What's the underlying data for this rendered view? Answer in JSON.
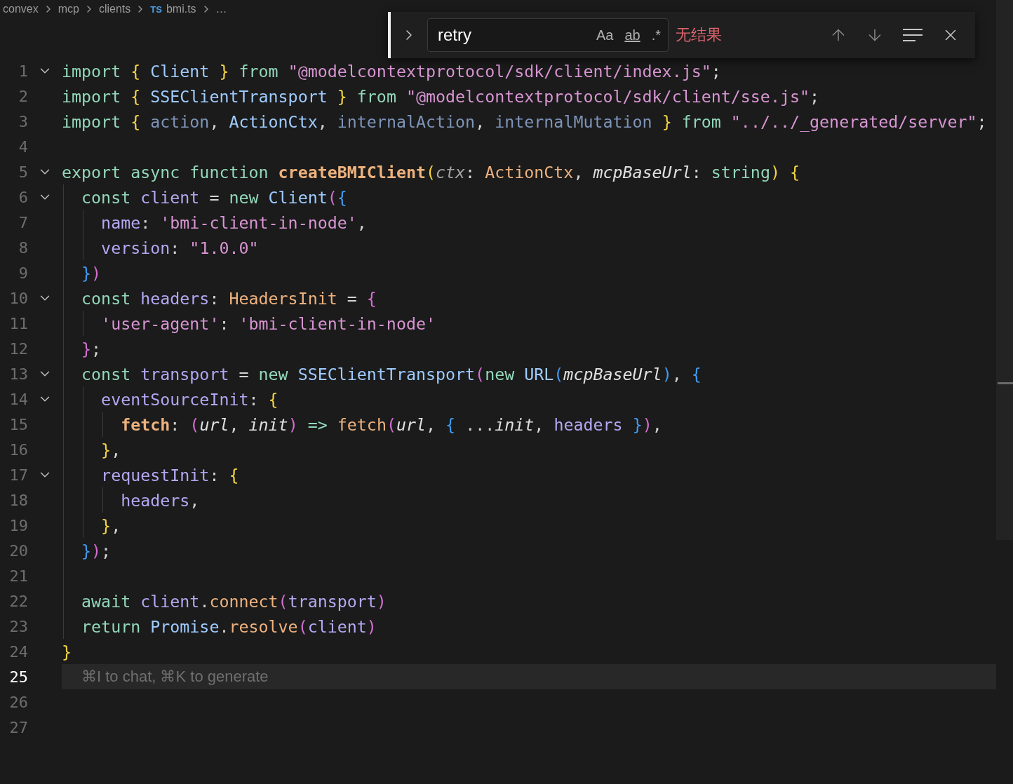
{
  "breadcrumb": {
    "items": [
      {
        "label": "convex",
        "kind": "folder"
      },
      {
        "label": "mcp",
        "kind": "folder"
      },
      {
        "label": "clients",
        "kind": "folder"
      },
      {
        "label": "bmi.ts",
        "kind": "file",
        "badge": "TS"
      },
      {
        "label": "…",
        "kind": "more"
      }
    ]
  },
  "find_widget": {
    "query": "retry",
    "options": [
      {
        "kind": "case",
        "label": "Aa"
      },
      {
        "kind": "word",
        "label": "ab"
      },
      {
        "kind": "regex",
        "label": ".*"
      }
    ],
    "status": "无结果"
  },
  "editor": {
    "hint": "⌘I to chat, ⌘K to generate",
    "lines": [
      {
        "number": "1",
        "fold_expanded": true,
        "tokens": [
          {
            "kind": "kw",
            "text": "import "
          },
          {
            "kind": "b1",
            "text": "{"
          },
          {
            "kind": "type",
            "text": " Client "
          },
          {
            "kind": "b1",
            "text": "}"
          },
          {
            "kind": "kw",
            "text": " from "
          },
          {
            "kind": "str",
            "text": "\"@modelcontextprotocol/sdk/client/index.js\""
          },
          {
            "kind": "p",
            "text": ";"
          }
        ]
      },
      {
        "number": "2",
        "tokens": [
          {
            "kind": "kw",
            "text": "import "
          },
          {
            "kind": "b1",
            "text": "{"
          },
          {
            "kind": "type",
            "text": " SSEClientTransport "
          },
          {
            "kind": "b1",
            "text": "}"
          },
          {
            "kind": "kw",
            "text": " from "
          },
          {
            "kind": "str",
            "text": "\"@modelcontextprotocol/sdk/client/sse.js\""
          },
          {
            "kind": "p",
            "text": ";"
          }
        ]
      },
      {
        "number": "3",
        "tokens": [
          {
            "kind": "kw",
            "text": "import "
          },
          {
            "kind": "b1",
            "text": "{"
          },
          {
            "kind": "dim",
            "text": " action"
          },
          {
            "kind": "p",
            "text": ", "
          },
          {
            "kind": "type",
            "text": "ActionCtx"
          },
          {
            "kind": "p",
            "text": ", "
          },
          {
            "kind": "dim",
            "text": "internalAction"
          },
          {
            "kind": "p",
            "text": ", "
          },
          {
            "kind": "dim",
            "text": "internalMutation "
          },
          {
            "kind": "b1",
            "text": "}"
          },
          {
            "kind": "kw",
            "text": " from "
          },
          {
            "kind": "str",
            "text": "\"../../_generated/server\""
          },
          {
            "kind": "p",
            "text": ";"
          }
        ]
      },
      {
        "number": "4"
      },
      {
        "number": "5",
        "fold_expanded": true,
        "tokens": [
          {
            "kind": "kw",
            "text": "export async function "
          },
          {
            "kind": "fnb",
            "text": "createBMIClient"
          },
          {
            "kind": "b1",
            "text": "("
          },
          {
            "kind": "paramdim",
            "text": "ctx"
          },
          {
            "kind": "p",
            "text": ": "
          },
          {
            "kind": "fn",
            "text": "ActionCtx"
          },
          {
            "kind": "p",
            "text": ", "
          },
          {
            "kind": "param",
            "text": "mcpBaseUrl"
          },
          {
            "kind": "p",
            "text": ": "
          },
          {
            "kind": "kw",
            "text": "string"
          },
          {
            "kind": "b1",
            "text": ") {"
          }
        ]
      },
      {
        "number": "6",
        "fold_expanded": true,
        "tokens": [
          {
            "kind": "kw",
            "text": "  const"
          },
          {
            "kind": "var",
            "text": " client"
          },
          {
            "kind": "p",
            "text": " = "
          },
          {
            "kind": "kw",
            "text": "new"
          },
          {
            "kind": "type",
            "text": " Client"
          },
          {
            "kind": "b2",
            "text": "("
          },
          {
            "kind": "b3",
            "text": "{"
          }
        ]
      },
      {
        "number": "7",
        "tokens": [
          {
            "kind": "var",
            "text": "    name"
          },
          {
            "kind": "p",
            "text": ": "
          },
          {
            "kind": "str",
            "text": "'bmi-client-in-node'"
          },
          {
            "kind": "p",
            "text": ","
          }
        ]
      },
      {
        "number": "8",
        "tokens": [
          {
            "kind": "var",
            "text": "    version"
          },
          {
            "kind": "p",
            "text": ": "
          },
          {
            "kind": "str",
            "text": "\"1.0.0\""
          }
        ]
      },
      {
        "number": "9",
        "tokens": [
          {
            "kind": "b3",
            "text": "  }"
          },
          {
            "kind": "b2",
            "text": ")"
          }
        ]
      },
      {
        "number": "10",
        "fold_expanded": true,
        "tokens": [
          {
            "kind": "kw",
            "text": "  const"
          },
          {
            "kind": "var",
            "text": " headers"
          },
          {
            "kind": "p",
            "text": ": "
          },
          {
            "kind": "fn",
            "text": "HeadersInit"
          },
          {
            "kind": "p",
            "text": " = "
          },
          {
            "kind": "b2",
            "text": "{"
          }
        ]
      },
      {
        "number": "11",
        "tokens": [
          {
            "kind": "str",
            "text": "    'user-agent'"
          },
          {
            "kind": "p",
            "text": ": "
          },
          {
            "kind": "str",
            "text": "'bmi-client-in-node'"
          }
        ]
      },
      {
        "number": "12",
        "tokens": [
          {
            "kind": "b2",
            "text": "  }"
          },
          {
            "kind": "p",
            "text": ";"
          }
        ]
      },
      {
        "number": "13",
        "fold_expanded": true,
        "tokens": [
          {
            "kind": "kw",
            "text": "  const"
          },
          {
            "kind": "var",
            "text": " transport"
          },
          {
            "kind": "p",
            "text": " = "
          },
          {
            "kind": "kw",
            "text": "new"
          },
          {
            "kind": "type",
            "text": " SSEClientTransport"
          },
          {
            "kind": "b2",
            "text": "("
          },
          {
            "kind": "kw",
            "text": "new"
          },
          {
            "kind": "type",
            "text": " URL"
          },
          {
            "kind": "b3",
            "text": "("
          },
          {
            "kind": "param",
            "text": "mcpBaseUrl"
          },
          {
            "kind": "b3",
            "text": ")"
          },
          {
            "kind": "p",
            "text": ", "
          },
          {
            "kind": "b3",
            "text": "{"
          }
        ]
      },
      {
        "number": "14",
        "fold_expanded": true,
        "tokens": [
          {
            "kind": "var",
            "text": "    eventSourceInit"
          },
          {
            "kind": "p",
            "text": ": "
          },
          {
            "kind": "b1",
            "text": "{"
          }
        ]
      },
      {
        "number": "15",
        "tokens": [
          {
            "kind": "fnb",
            "text": "      fetch"
          },
          {
            "kind": "p",
            "text": ": "
          },
          {
            "kind": "b2",
            "text": "("
          },
          {
            "kind": "param",
            "text": "url"
          },
          {
            "kind": "p",
            "text": ", "
          },
          {
            "kind": "param",
            "text": "init"
          },
          {
            "kind": "b2",
            "text": ")"
          },
          {
            "kind": "kw",
            "text": " => "
          },
          {
            "kind": "fn",
            "text": "fetch"
          },
          {
            "kind": "b2",
            "text": "("
          },
          {
            "kind": "param",
            "text": "url"
          },
          {
            "kind": "p",
            "text": ", "
          },
          {
            "kind": "b3",
            "text": "{"
          },
          {
            "kind": "p",
            "text": " ..."
          },
          {
            "kind": "param",
            "text": "init"
          },
          {
            "kind": "p",
            "text": ", "
          },
          {
            "kind": "var",
            "text": "headers "
          },
          {
            "kind": "b3",
            "text": "}"
          },
          {
            "kind": "b2",
            "text": ")"
          },
          {
            "kind": "p",
            "text": ","
          }
        ]
      },
      {
        "number": "16",
        "tokens": [
          {
            "kind": "b1",
            "text": "    }"
          },
          {
            "kind": "p",
            "text": ","
          }
        ]
      },
      {
        "number": "17",
        "fold_expanded": true,
        "tokens": [
          {
            "kind": "var",
            "text": "    requestInit"
          },
          {
            "kind": "p",
            "text": ": "
          },
          {
            "kind": "b1",
            "text": "{"
          }
        ]
      },
      {
        "number": "18",
        "tokens": [
          {
            "kind": "var",
            "text": "      headers"
          },
          {
            "kind": "p",
            "text": ","
          }
        ]
      },
      {
        "number": "19",
        "tokens": [
          {
            "kind": "b1",
            "text": "    }"
          },
          {
            "kind": "p",
            "text": ","
          }
        ]
      },
      {
        "number": "20",
        "tokens": [
          {
            "kind": "b3",
            "text": "  }"
          },
          {
            "kind": "b2",
            "text": ")"
          },
          {
            "kind": "p",
            "text": ";"
          }
        ]
      },
      {
        "number": "21"
      },
      {
        "number": "22",
        "tokens": [
          {
            "kind": "kw",
            "text": "  await"
          },
          {
            "kind": "var",
            "text": " client"
          },
          {
            "kind": "p",
            "text": "."
          },
          {
            "kind": "fn",
            "text": "connect"
          },
          {
            "kind": "b2",
            "text": "("
          },
          {
            "kind": "var",
            "text": "transport"
          },
          {
            "kind": "b2",
            "text": ")"
          }
        ]
      },
      {
        "number": "23",
        "tokens": [
          {
            "kind": "kw",
            "text": "  return"
          },
          {
            "kind": "type",
            "text": " Promise"
          },
          {
            "kind": "p",
            "text": "."
          },
          {
            "kind": "fn",
            "text": "resolve"
          },
          {
            "kind": "b2",
            "text": "("
          },
          {
            "kind": "var",
            "text": "client"
          },
          {
            "kind": "b2",
            "text": ")"
          }
        ]
      },
      {
        "number": "24",
        "tokens": [
          {
            "kind": "b1",
            "text": "}"
          }
        ]
      },
      {
        "number": "25",
        "current": true
      },
      {
        "number": "26"
      },
      {
        "number": "27"
      }
    ]
  }
}
